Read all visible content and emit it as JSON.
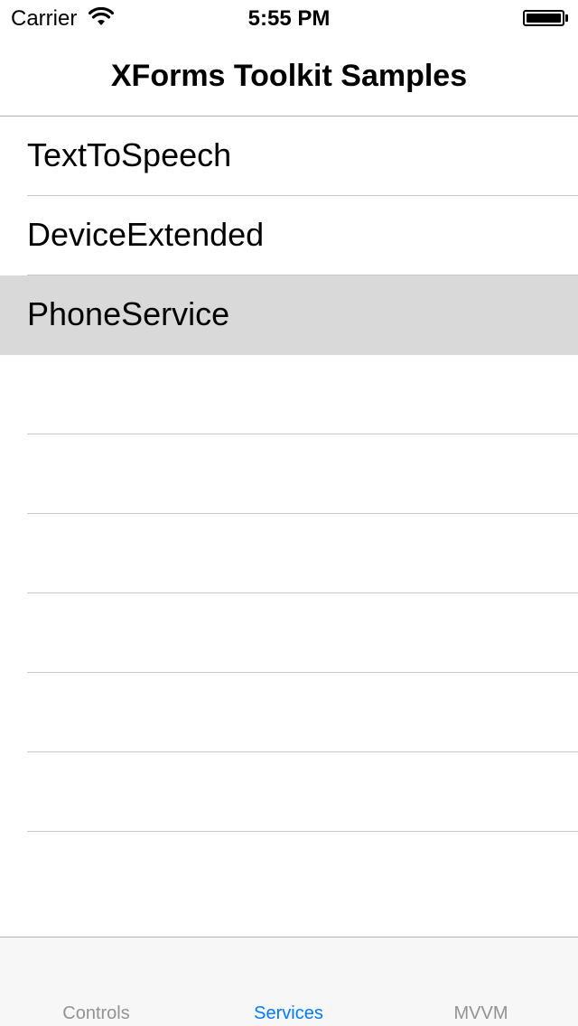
{
  "status_bar": {
    "carrier": "Carrier",
    "time": "5:55 PM",
    "wifi_icon": "wifi-icon",
    "battery_icon": "battery-icon"
  },
  "nav_bar": {
    "title": "XForms Toolkit Samples"
  },
  "list": {
    "items": [
      {
        "label": "TextToSpeech",
        "selected": false
      },
      {
        "label": "DeviceExtended",
        "selected": false
      },
      {
        "label": "PhoneService",
        "selected": true
      }
    ],
    "empty_rows": 7
  },
  "tab_bar": {
    "tabs": [
      {
        "label": "Controls",
        "active": false
      },
      {
        "label": "Services",
        "active": true
      },
      {
        "label": "MVVM",
        "active": false
      }
    ]
  },
  "colors": {
    "accent": "#007aff",
    "inactive_tab": "#929292",
    "selected_row": "#d9d9d9",
    "separator": "#c8c7cc",
    "tab_bar_bg": "#f7f7f7"
  }
}
